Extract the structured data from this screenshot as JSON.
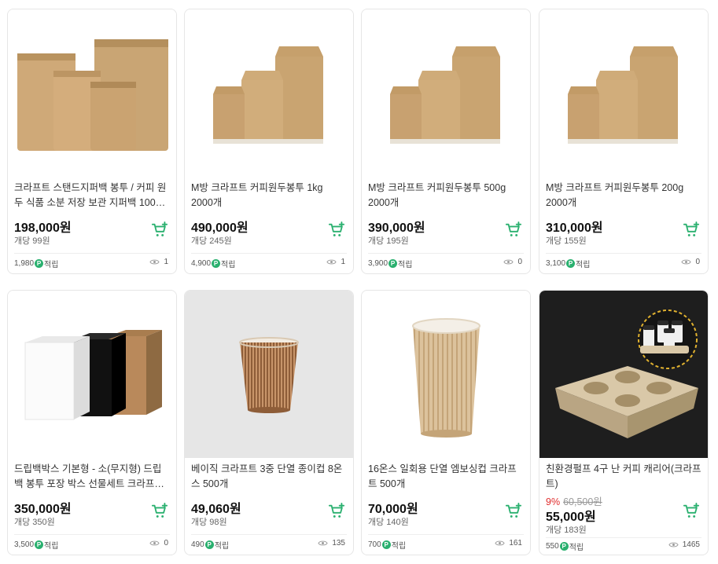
{
  "colors": {
    "accent": "#2ab06f",
    "discount": "#e02d2d"
  },
  "products": [
    {
      "name": "크라프트 스탠드지퍼백 봉투 / 커피 원두 식품 소분 저장 보관 지퍼백 100g ...",
      "price": "198,000원",
      "unit": "개당 99원",
      "points": "1,980",
      "points_suffix": "적립",
      "views": "1",
      "image": "kraft-zipper-bags",
      "cart_icon": "cart-plus-icon"
    },
    {
      "name": "M방 크라프트 커피원두봉투 1kg 2000개",
      "price": "490,000원",
      "unit": "개당 245원",
      "points": "4,900",
      "points_suffix": "적립",
      "views": "1",
      "image": "kraft-coffee-bags",
      "cart_icon": "cart-plus-icon"
    },
    {
      "name": "M방 크라프트 커피원두봉투 500g 2000개",
      "price": "390,000원",
      "unit": "개당 195원",
      "points": "3,900",
      "points_suffix": "적립",
      "views": "0",
      "image": "kraft-coffee-bags",
      "cart_icon": "cart-plus-icon"
    },
    {
      "name": "M방 크라프트 커피원두봉투 200g 2000개",
      "price": "310,000원",
      "unit": "개당 155원",
      "points": "3,100",
      "points_suffix": "적립",
      "views": "0",
      "image": "kraft-coffee-bags",
      "cart_icon": "cart-plus-icon"
    },
    {
      "name": "드립백박스 기본형 - 소(무지형) 드립백 봉투 포장 박스 선물세트 크라프트 ...",
      "price": "350,000원",
      "unit": "개당 350원",
      "points": "3,500",
      "points_suffix": "적립",
      "views": "0",
      "image": "drip-bag-boxes",
      "cart_icon": "cart-plus-icon"
    },
    {
      "name": "베이직 크라프트 3중 단열 종이컵 8온스 500개",
      "price": "49,060원",
      "unit": "개당 98원",
      "points": "490",
      "points_suffix": "적립",
      "views": "135",
      "image": "ripple-cup-small",
      "cart_icon": "cart-plus-icon"
    },
    {
      "name": "16온스 일회용 단열 엠보싱컵 크라프트 500개",
      "price": "70,000원",
      "unit": "개당 140원",
      "points": "700",
      "points_suffix": "적립",
      "views": "161",
      "image": "ripple-cup-tall",
      "cart_icon": "cart-plus-icon"
    },
    {
      "name": "친환경펄프 4구 난 커피 캐리어(크라프트)",
      "discount": "9%",
      "original_price": "60,500원",
      "price": "55,000원",
      "unit": "개당 183원",
      "points": "550",
      "points_suffix": "적립",
      "views": "1465",
      "image": "pulp-cup-carrier",
      "cart_icon": "cart-plus-icon"
    }
  ]
}
